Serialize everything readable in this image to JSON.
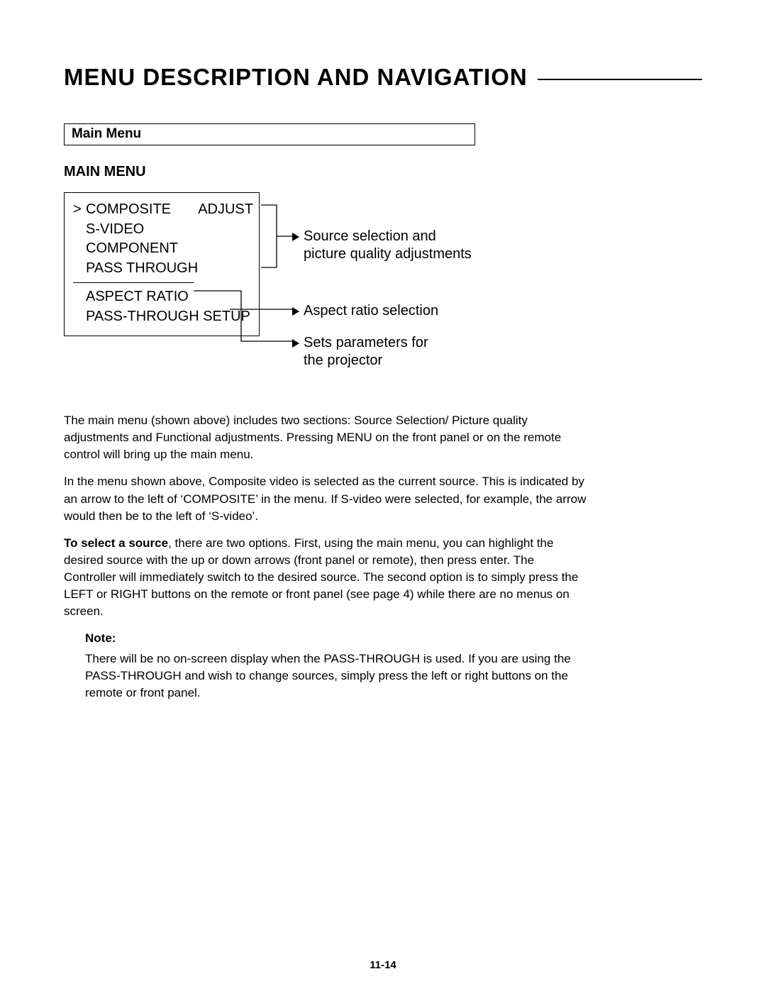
{
  "chapter_title": "MENU DESCRIPTION AND NAVIGATION",
  "section_box": "Main Menu",
  "diagram": {
    "menu_title": "MAIN MENU",
    "rows_top": [
      {
        "caret": ">",
        "left": "COMPOSITE",
        "right": "ADJUST"
      },
      {
        "caret": "",
        "left": "S-VIDEO",
        "right": ""
      },
      {
        "caret": "",
        "left": "COMPONENT",
        "right": ""
      },
      {
        "caret": "",
        "left": "PASS THROUGH",
        "right": ""
      }
    ],
    "rows_bottom": [
      "ASPECT RATIO",
      "PASS-THROUGH SETUP"
    ],
    "callout1_line1": "Source selection and",
    "callout1_line2": "picture quality adjustments",
    "callout2": "Aspect ratio selection",
    "callout3_line1": "Sets parameters for",
    "callout3_line2": "the projector"
  },
  "paragraphs": {
    "p1": "The main menu (shown above) includes two sections: Source Selection/ Picture quality adjustments and Functional adjustments. Pressing MENU on the front panel or on the remote control will bring up the main menu.",
    "p2": "In the menu shown above, Composite video is selected as the current source. This is indicated by an arrow to the left of ‘COMPOSITE’ in the menu. If S-video were selected, for example, the arrow would then be to the left of ‘S-video’.",
    "p3_bold": "To select a source",
    "p3_rest": ", there are two options. First, using the main menu, you can highlight the desired source with the up or down arrows (front panel or remote), then press enter. The Controller will immediately switch to the desired source. The second option is to simply press the LEFT or RIGHT buttons on the remote or front panel (see page 4) while there are no menus on screen.",
    "note_label": "Note:",
    "note_body": "There will be no on-screen display when the PASS-THROUGH is used. If you are using the PASS-THROUGH and wish to change sources, simply press the left or right buttons on the remote or front panel."
  },
  "page_number": "11-14"
}
